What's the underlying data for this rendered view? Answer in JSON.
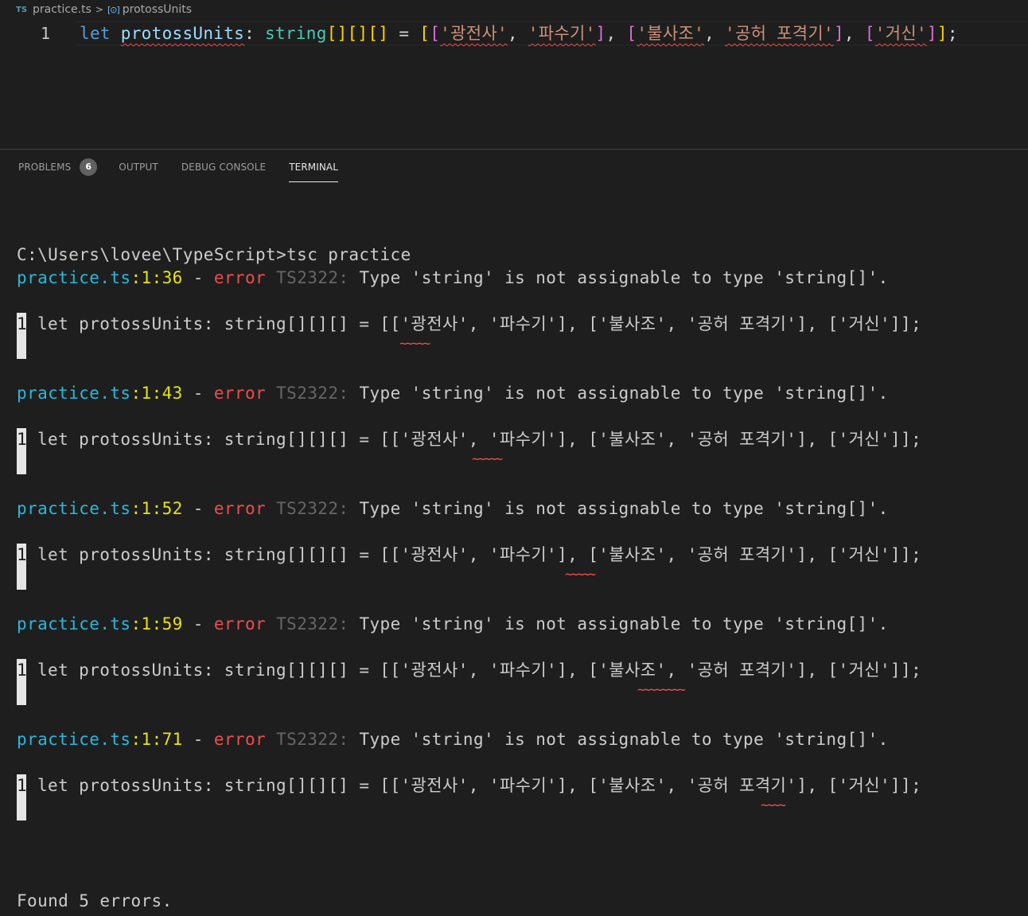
{
  "breadcrumb": {
    "lang_badge": "TS",
    "file": "practice.ts",
    "separator": ">",
    "symbol_icon": "[⊙]",
    "symbol": "protossUnits"
  },
  "editor": {
    "line_number": "1",
    "tokens": {
      "let": "let",
      "name": "protossUnits",
      "colon": ":",
      "type": "string",
      "brackets": "[][][]",
      "eq": "=",
      "open2": "[[",
      "s1": "'광전사'",
      "comma": ",",
      "s2": "'파수기'",
      "close1": "]",
      "open1": "[",
      "s3": "'불사조'",
      "s4": "'공허 포격기'",
      "s5": "'거신'",
      "close2": "]]",
      "semi": ";"
    }
  },
  "panel": {
    "tabs": [
      {
        "label": "PROBLEMS",
        "badge": "6"
      },
      {
        "label": "OUTPUT"
      },
      {
        "label": "DEBUG CONSOLE"
      },
      {
        "label": "TERMINAL"
      }
    ]
  },
  "terminal": {
    "prompt": "C:\\Users\\lovee\\TypeScript>tsc practice",
    "errors": [
      {
        "file": "practice.ts",
        "loc": ":1:36",
        "dash": " - ",
        "level": "error",
        "code": "TS2322:",
        "message": "Type 'string' is not assignable to type 'string[]'.",
        "line_no": "1",
        "source": "let protossUnits: string[][][] = [['광전사', '파수기'], ['불사조', '공허 포격기'], ['거신']];",
        "tilde": "~~~~~"
      },
      {
        "file": "practice.ts",
        "loc": ":1:43",
        "dash": " - ",
        "level": "error",
        "code": "TS2322:",
        "message": "Type 'string' is not assignable to type 'string[]'.",
        "line_no": "1",
        "source": "let protossUnits: string[][][] = [['광전사', '파수기'], ['불사조', '공허 포격기'], ['거신']];",
        "tilde": "~~~~~"
      },
      {
        "file": "practice.ts",
        "loc": ":1:52",
        "dash": " - ",
        "level": "error",
        "code": "TS2322:",
        "message": "Type 'string' is not assignable to type 'string[]'.",
        "line_no": "1",
        "source": "let protossUnits: string[][][] = [['광전사', '파수기'], ['불사조', '공허 포격기'], ['거신']];",
        "tilde": "~~~~~"
      },
      {
        "file": "practice.ts",
        "loc": ":1:59",
        "dash": " - ",
        "level": "error",
        "code": "TS2322:",
        "message": "Type 'string' is not assignable to type 'string[]'.",
        "line_no": "1",
        "source": "let protossUnits: string[][][] = [['광전사', '파수기'], ['불사조', '공허 포격기'], ['거신']];",
        "tilde": "~~~~~~~~"
      },
      {
        "file": "practice.ts",
        "loc": ":1:71",
        "dash": " - ",
        "level": "error",
        "code": "TS2322:",
        "message": "Type 'string' is not assignable to type 'string[]'.",
        "line_no": "1",
        "source": "let protossUnits: string[][][] = [['광전사', '파수기'], ['불사조', '공허 포격기'], ['거신']];",
        "tilde": "~~~~"
      }
    ],
    "summary": "Found 5 errors."
  },
  "colors": {
    "error": "#f14c4c",
    "file": "#29b8db",
    "location": "#e5e510",
    "code": "#666666",
    "accent": "#569cd6"
  }
}
